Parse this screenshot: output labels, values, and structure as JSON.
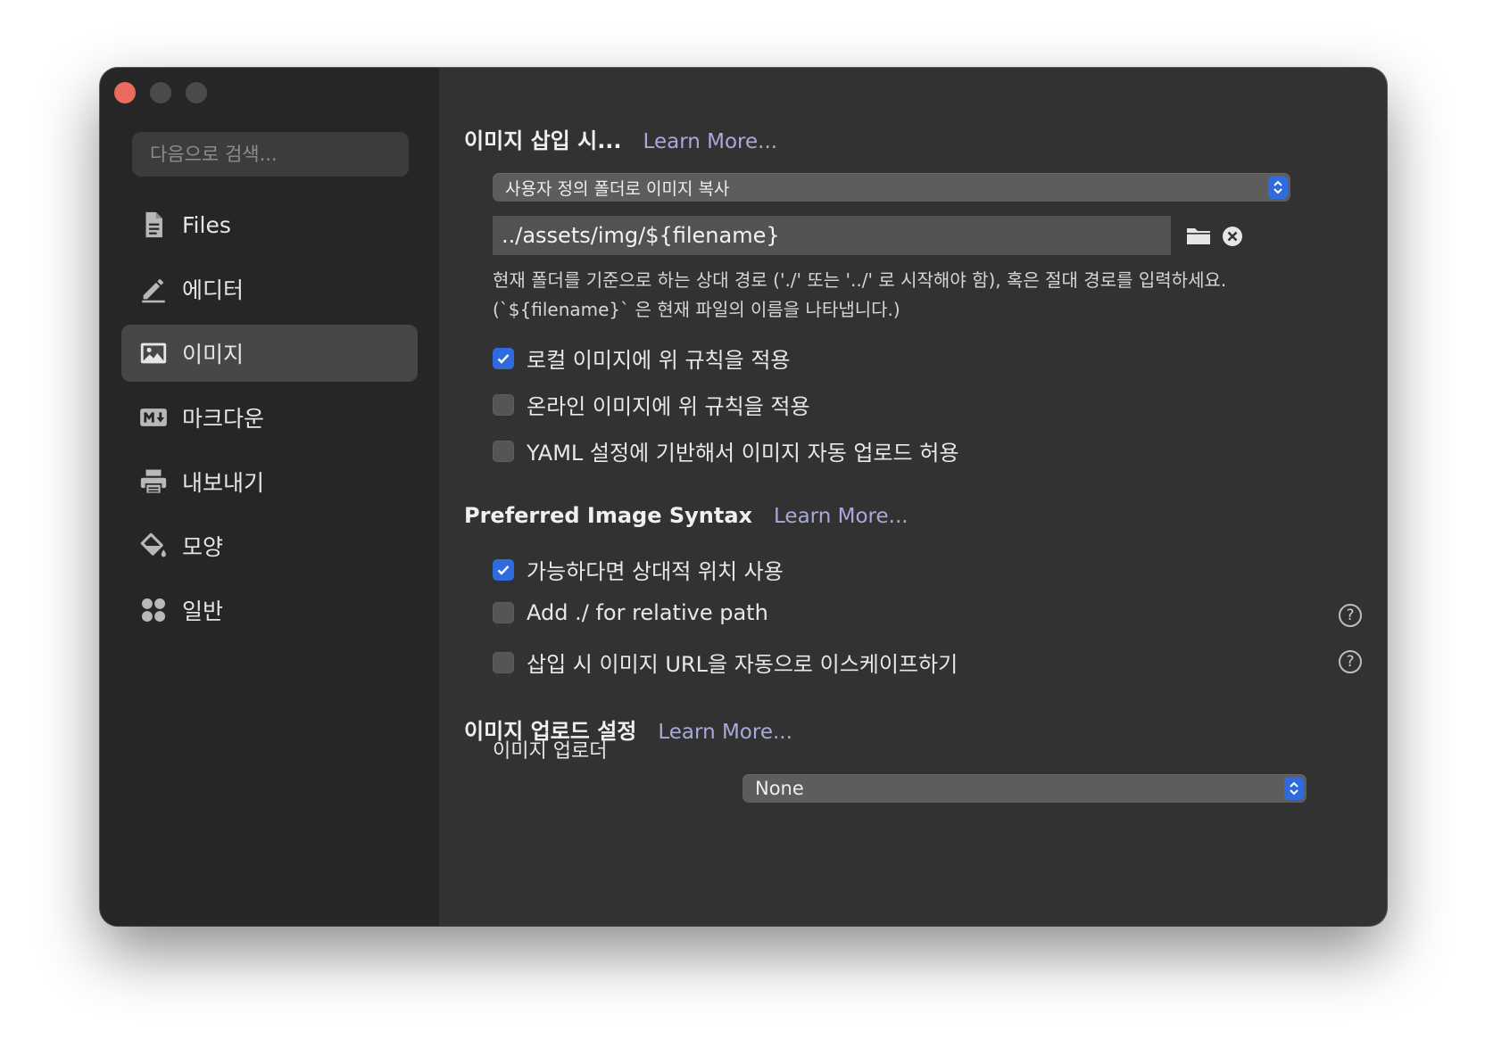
{
  "sidebar": {
    "search_placeholder": "다음으로 검색...",
    "items": [
      {
        "label": "Files",
        "icon": "document-icon"
      },
      {
        "label": "에디터",
        "icon": "pencil-icon"
      },
      {
        "label": "이미지",
        "icon": "image-icon",
        "active": true
      },
      {
        "label": "마크다운",
        "icon": "markdown-icon"
      },
      {
        "label": "내보내기",
        "icon": "printer-icon"
      },
      {
        "label": "모양",
        "icon": "paint-bucket-icon"
      },
      {
        "label": "일반",
        "icon": "grid-icon"
      }
    ]
  },
  "insert_section": {
    "title": "이미지 삽입 시...",
    "learn_more": "Learn More...",
    "action_select": "사용자 정의 폴더로 이미지 복사",
    "path_value": "../assets/img/${filename}",
    "hint": "현재 폴더를 기준으로 하는 상대 경로 ('./' 또는 '../' 로 시작해야 함), 혹은 절대 경로를 입력하세요. (`${filename}` 은 현재 파일의 이름을 나타냅니다.)",
    "options": [
      {
        "label": "로컬 이미지에 위 규칙을 적용",
        "checked": true
      },
      {
        "label": "온라인 이미지에 위 규칙을 적용",
        "checked": false
      },
      {
        "label": "YAML 설정에 기반해서 이미지 자동 업로드 허용",
        "checked": false
      }
    ]
  },
  "syntax_section": {
    "title": "Preferred Image Syntax",
    "learn_more": "Learn More...",
    "options": [
      {
        "label": "가능하다면 상대적 위치 사용",
        "checked": true
      },
      {
        "label": "Add ./ for relative path",
        "checked": false
      },
      {
        "label": "삽입 시 이미지 URL을 자동으로 이스케이프하기",
        "checked": false
      }
    ],
    "help": "?"
  },
  "upload_section": {
    "title": "이미지 업로드 설정",
    "learn_more": "Learn More...",
    "uploader_label": "이미지 업로더",
    "uploader_value": "None"
  },
  "colors": {
    "accent": "#2f6bdd",
    "close": "#ed6a5e"
  }
}
